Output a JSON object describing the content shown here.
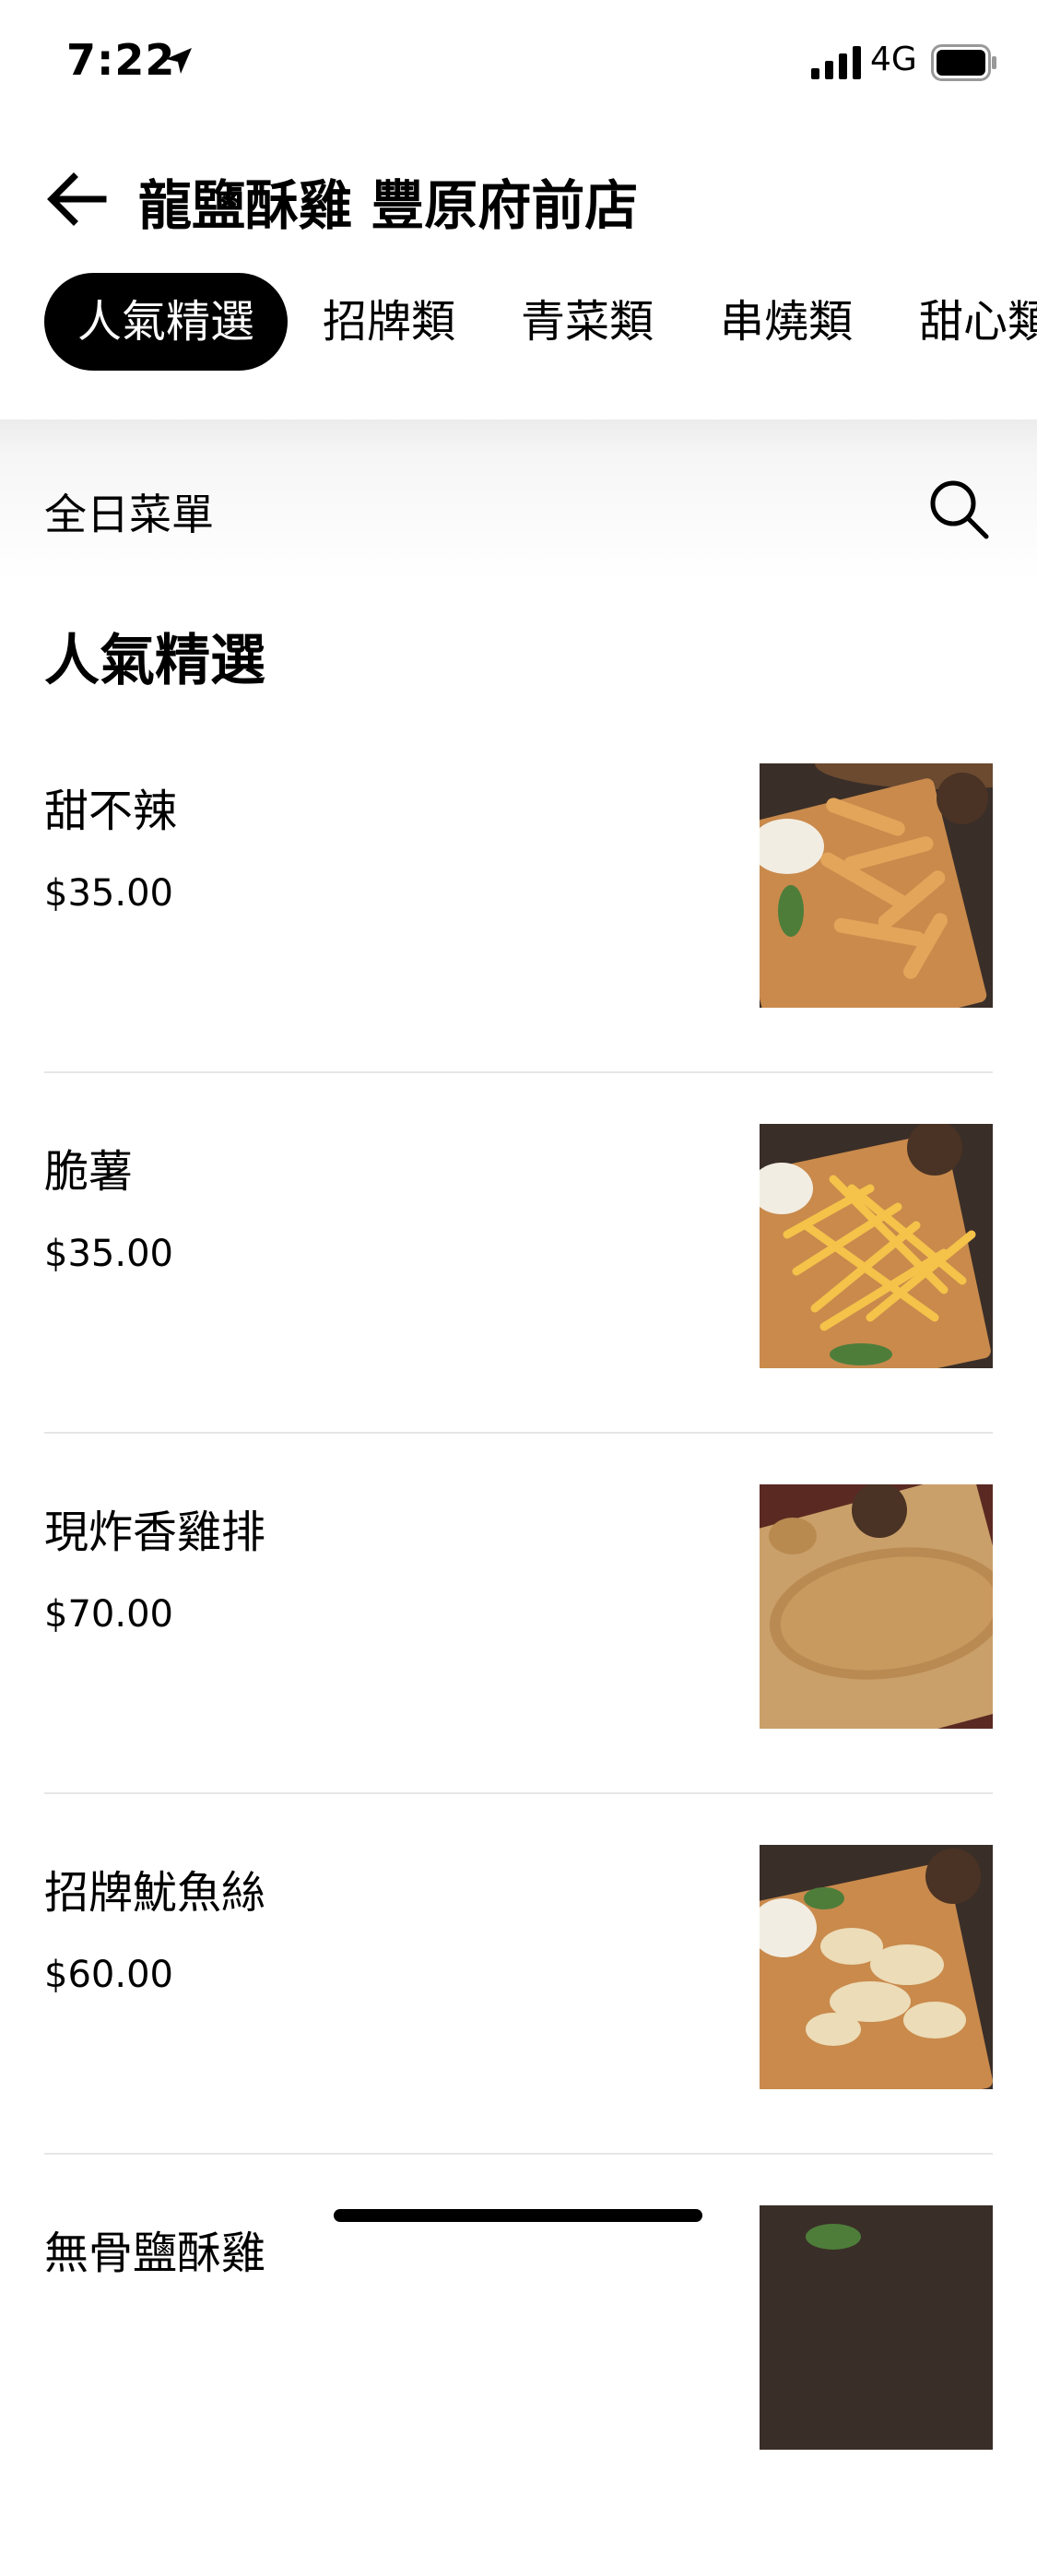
{
  "status_bar": {
    "time": "7:22",
    "network": "4G"
  },
  "header": {
    "title": "龍鹽酥雞 豐原府前店"
  },
  "tabs": [
    {
      "label": "人氣精選",
      "active": true
    },
    {
      "label": "招牌類",
      "active": false
    },
    {
      "label": "青菜類",
      "active": false
    },
    {
      "label": "串燒類",
      "active": false
    },
    {
      "label": "甜心類",
      "active": false
    }
  ],
  "menu": {
    "label": "全日菜單"
  },
  "section": {
    "title": "人氣精選"
  },
  "items": [
    {
      "name": "甜不辣",
      "price": "$35.00",
      "image": "fried-tempura-photo"
    },
    {
      "name": "脆薯",
      "price": "$35.00",
      "image": "french-fries-photo"
    },
    {
      "name": "現炸香雞排",
      "price": "$70.00",
      "image": "fried-chicken-cutlet-photo"
    },
    {
      "name": "招牌魷魚絲",
      "price": "$60.00",
      "image": "fried-squid-strips-photo"
    },
    {
      "name": "無骨鹽酥雞",
      "price": "",
      "image": "popcorn-chicken-photo"
    }
  ],
  "colors": {
    "accent": "#000000",
    "board": "#c98a4c",
    "mat": "#3a2e28"
  }
}
